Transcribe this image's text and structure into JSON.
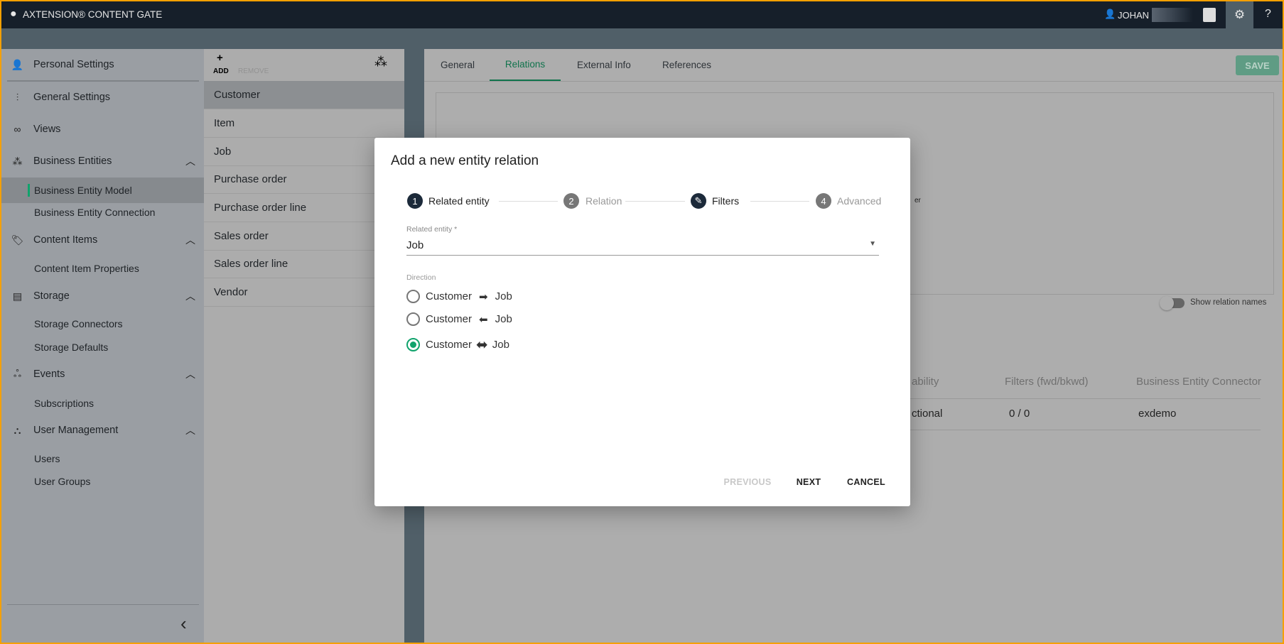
{
  "app": {
    "title": "AXTENSION® CONTENT GATE",
    "user": "JOHAN",
    "icons": [
      "logo-icon",
      "user-icon",
      "clipboard-icon",
      "gear-icon",
      "help-icon"
    ],
    "help_label": "?"
  },
  "sidebar": {
    "items": [
      {
        "label": "Personal Settings",
        "icon": "person-icon"
      },
      {
        "label": "General Settings",
        "icon": "sliders-icon"
      },
      {
        "label": "Views",
        "icon": "glasses-icon"
      },
      {
        "label": "Business Entities",
        "icon": "hierarchy-icon",
        "expanded": true
      },
      {
        "label": "Business Entity Model",
        "selected": true
      },
      {
        "label": "Business Entity Connection"
      },
      {
        "label": "Content Items",
        "icon": "tag-icon",
        "expanded": true
      },
      {
        "label": "Content Item Properties"
      },
      {
        "label": "Storage",
        "icon": "archive-icon",
        "expanded": true
      },
      {
        "label": "Storage Connectors"
      },
      {
        "label": "Storage Defaults"
      },
      {
        "label": "Events",
        "icon": "webhook-icon",
        "expanded": true
      },
      {
        "label": "Subscriptions"
      },
      {
        "label": "User Management",
        "icon": "org-chart-icon",
        "expanded": true
      },
      {
        "label": "Users"
      },
      {
        "label": "User Groups"
      }
    ]
  },
  "entity_list": {
    "add_label": "ADD",
    "remove_label": "REMOVE",
    "items": [
      "Customer",
      "Item",
      "Job",
      "Purchase order",
      "Purchase order line",
      "Sales order",
      "Sales order line",
      "Vendor"
    ],
    "selected": "Customer"
  },
  "main": {
    "tabs": [
      "General",
      "Relations",
      "External Info",
      "References"
    ],
    "active_tab": "Relations",
    "save_label": "SAVE",
    "graph_fragment": "er",
    "toggle_label": "Show relation names",
    "toggle_on": false,
    "table": {
      "headers": [
        "ability",
        "Filters (fwd/bkwd)",
        "Business Entity Connector"
      ],
      "rows": [
        [
          "ctional",
          "0 / 0",
          "exdemo"
        ]
      ]
    }
  },
  "dialog": {
    "title": "Add a new entity relation",
    "steps": [
      {
        "num": "1",
        "label": "Related entity",
        "state": "active"
      },
      {
        "num": "2",
        "label": "Relation",
        "state": "inactive"
      },
      {
        "num": "",
        "label": "Filters",
        "state": "edited"
      },
      {
        "num": "4",
        "label": "Advanced",
        "state": "inactive"
      }
    ],
    "field_label": "Related entity *",
    "field_value": "Job",
    "direction_label": "Direction",
    "options": [
      {
        "from": "Customer",
        "arrow": "➡",
        "to": "Job",
        "selected": false
      },
      {
        "from": "Customer",
        "arrow": "⬅",
        "to": "Job",
        "selected": false
      },
      {
        "from": "Customer",
        "arrow": "⬌",
        "to": "Job",
        "selected": true
      }
    ],
    "previous_label": "PREVIOUS",
    "next_label": "NEXT",
    "cancel_label": "CANCEL"
  },
  "colors": {
    "accent": "#10a36c",
    "topbar": "#161f2a",
    "step_active": "#1c2a3a"
  }
}
